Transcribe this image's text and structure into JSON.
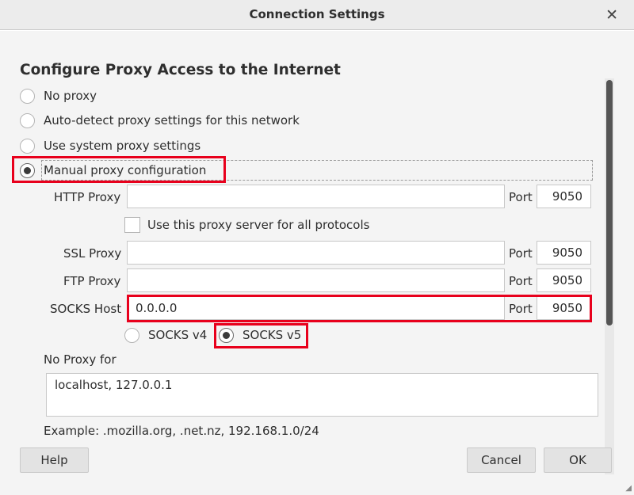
{
  "window": {
    "title": "Connection Settings",
    "close_glyph": "✕"
  },
  "heading": "Configure Proxy Access to the Internet",
  "proxy_options": [
    {
      "label": "No proxy",
      "checked": false
    },
    {
      "label": "Auto-detect proxy settings for this network",
      "checked": false
    },
    {
      "label": "Use system proxy settings",
      "checked": false
    },
    {
      "label": "Manual proxy configuration",
      "checked": true
    }
  ],
  "http": {
    "label": "HTTP Proxy",
    "value": "",
    "port_label": "Port",
    "port": "9050"
  },
  "all_protocols_checkbox": {
    "label": "Use this proxy server for all protocols",
    "checked": false
  },
  "ssl": {
    "label": "SSL Proxy",
    "value": "",
    "port_label": "Port",
    "port": "9050"
  },
  "ftp": {
    "label": "FTP Proxy",
    "value": "",
    "port_label": "Port",
    "port": "9050"
  },
  "socks": {
    "label": "SOCKS Host",
    "value": "0.0.0.0",
    "port_label": "Port",
    "port": "9050"
  },
  "socks_versions": [
    {
      "label": "SOCKS v4",
      "checked": false
    },
    {
      "label": "SOCKS v5",
      "checked": true
    }
  ],
  "no_proxy": {
    "label": "No Proxy for",
    "value": "localhost, 127.0.0.1"
  },
  "example": "Example: .mozilla.org, .net.nz, 192.168.1.0/24",
  "buttons": {
    "help": "Help",
    "cancel": "Cancel",
    "ok": "OK"
  },
  "colors": {
    "highlight": "#e8001c",
    "background": "#f4f4f4"
  }
}
